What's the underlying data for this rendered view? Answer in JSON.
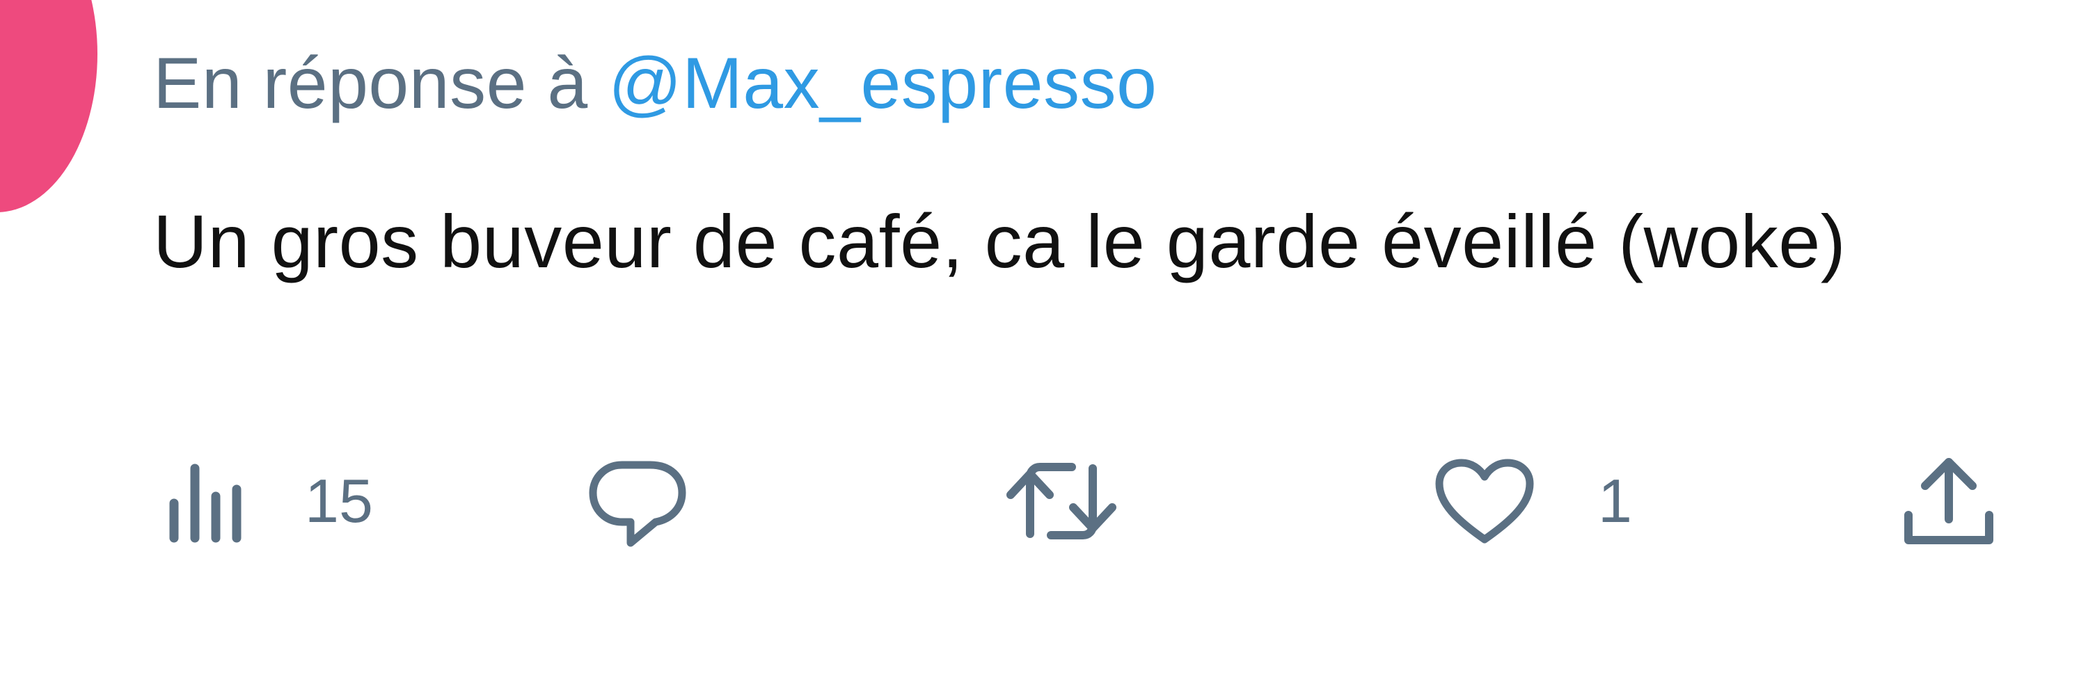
{
  "tweet": {
    "reply_to_prefix": "En réponse à",
    "reply_to_handle": "@Max_espresso",
    "text": "Un gros buveur de café, ca le garde éveillé (woke)"
  },
  "actions": {
    "views": {
      "icon": "views-chart-icon",
      "count": "15"
    },
    "reply": {
      "icon": "reply-bubble-icon"
    },
    "retweet": {
      "icon": "retweet-icon"
    },
    "like": {
      "icon": "heart-icon",
      "count": "1"
    },
    "share": {
      "icon": "share-upload-icon"
    }
  },
  "colors": {
    "avatar": "#ee4a7e",
    "muted_text": "#5b7083",
    "link": "#2f9ae3",
    "body_text": "#111111"
  }
}
